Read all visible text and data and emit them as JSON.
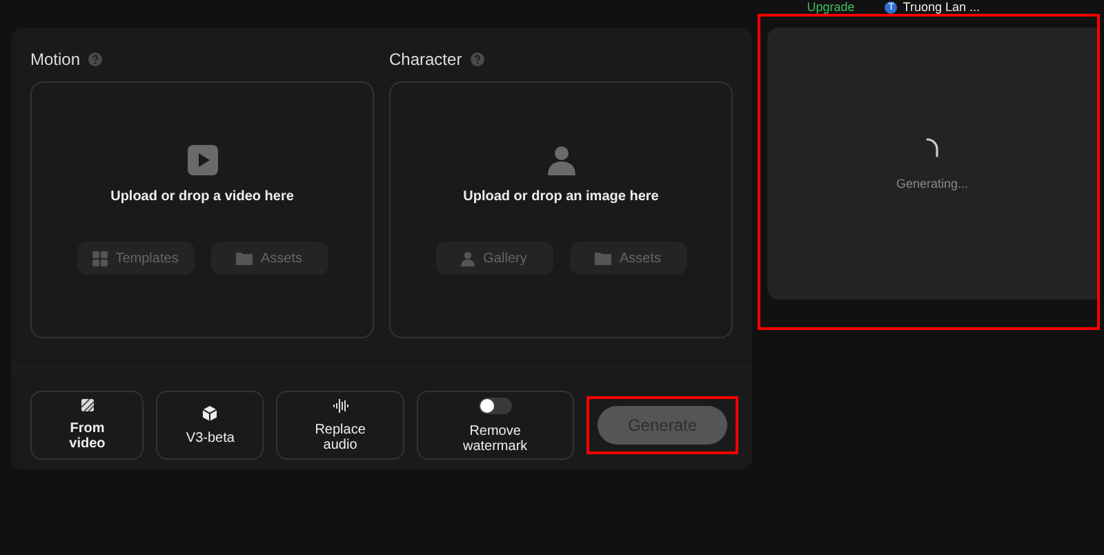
{
  "top_bar": {
    "upgrade": "Upgrade",
    "user": {
      "initial": "T",
      "name": "Truong Lan ..."
    }
  },
  "uploads": [
    {
      "kind": "video",
      "label": "Motion",
      "prompt": "Upload or drop a video here",
      "buttons": [
        {
          "kind": "templates",
          "label": "Templates"
        },
        {
          "kind": "folder",
          "label": "Assets"
        }
      ]
    },
    {
      "kind": "image",
      "label": "Character",
      "prompt": "Upload or drop an image here",
      "buttons": [
        {
          "kind": "person",
          "label": "Gallery"
        },
        {
          "kind": "folder",
          "label": "Assets"
        }
      ]
    }
  ],
  "options": [
    {
      "kind": "source",
      "label": "From video",
      "selected": true
    },
    {
      "kind": "model",
      "label": "V3-beta",
      "selected": false
    },
    {
      "kind": "audio",
      "label": "Replace audio",
      "selected": false
    },
    {
      "kind": "toggle",
      "label": "Remove watermark",
      "on": false
    }
  ],
  "generate": {
    "label": "Generate",
    "disabled": true,
    "highlighted": true
  },
  "preview": {
    "status": "Generating...",
    "highlighted": true
  }
}
